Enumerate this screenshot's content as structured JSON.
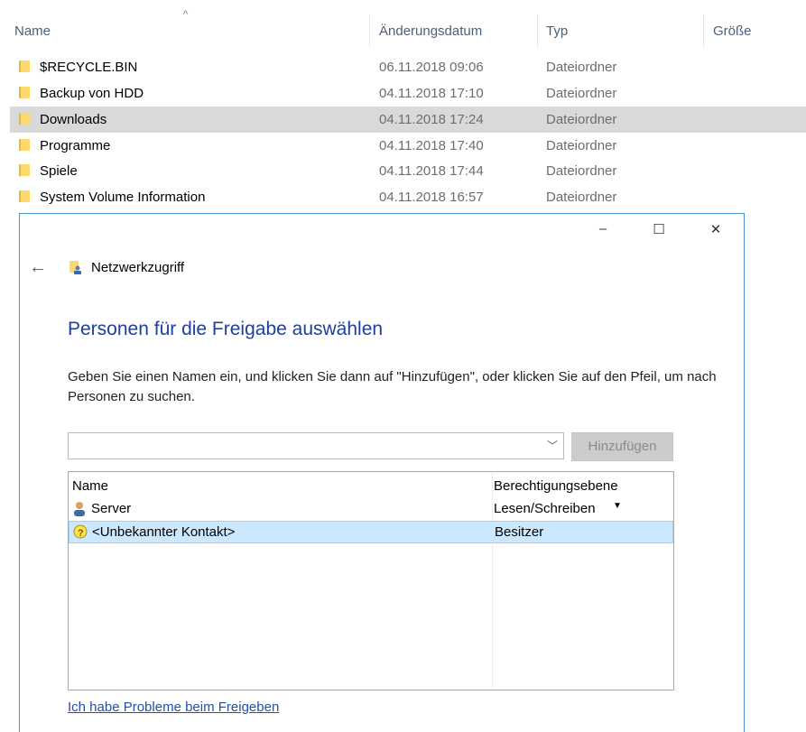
{
  "explorer": {
    "columns": {
      "name": "Name",
      "date": "Änderungsdatum",
      "type": "Typ",
      "size": "Größe"
    },
    "rows": [
      {
        "name": "$RECYCLE.BIN",
        "date": "06.11.2018 09:06",
        "type": "Dateiordner"
      },
      {
        "name": "Backup von HDD",
        "date": "04.11.2018 17:10",
        "type": "Dateiordner"
      },
      {
        "name": "Downloads",
        "date": "04.11.2018 17:24",
        "type": "Dateiordner"
      },
      {
        "name": "Programme",
        "date": "04.11.2018 17:40",
        "type": "Dateiordner"
      },
      {
        "name": "Spiele",
        "date": "04.11.2018 17:44",
        "type": "Dateiordner"
      },
      {
        "name": "System Volume Information",
        "date": "04.11.2018 16:57",
        "type": "Dateiordner"
      }
    ]
  },
  "dialog": {
    "window_buttons": {
      "minimize": "–",
      "maximize": "☐",
      "close": "✕"
    },
    "back_icon": "←",
    "breadcrumb": "Netzwerkzugriff",
    "heading": "Personen für die Freigabe auswählen",
    "description": "Geben Sie einen Namen ein, und klicken Sie dann auf \"Hinzufügen\", oder klicken Sie auf den Pfeil, um nach Personen zu suchen.",
    "input_value": "",
    "add_button": "Hinzufügen",
    "list": {
      "headers": {
        "name": "Name",
        "permission": "Berechtigungsebene"
      },
      "rows": [
        {
          "name": "Server",
          "permission": "Lesen/Schreiben",
          "icon": "user-icon"
        },
        {
          "name": "<Unbekannter Kontakt>",
          "permission": "Besitzer",
          "icon": "unknown-contact-icon"
        }
      ]
    },
    "help_link": "Ich habe Probleme beim Freigeben"
  }
}
